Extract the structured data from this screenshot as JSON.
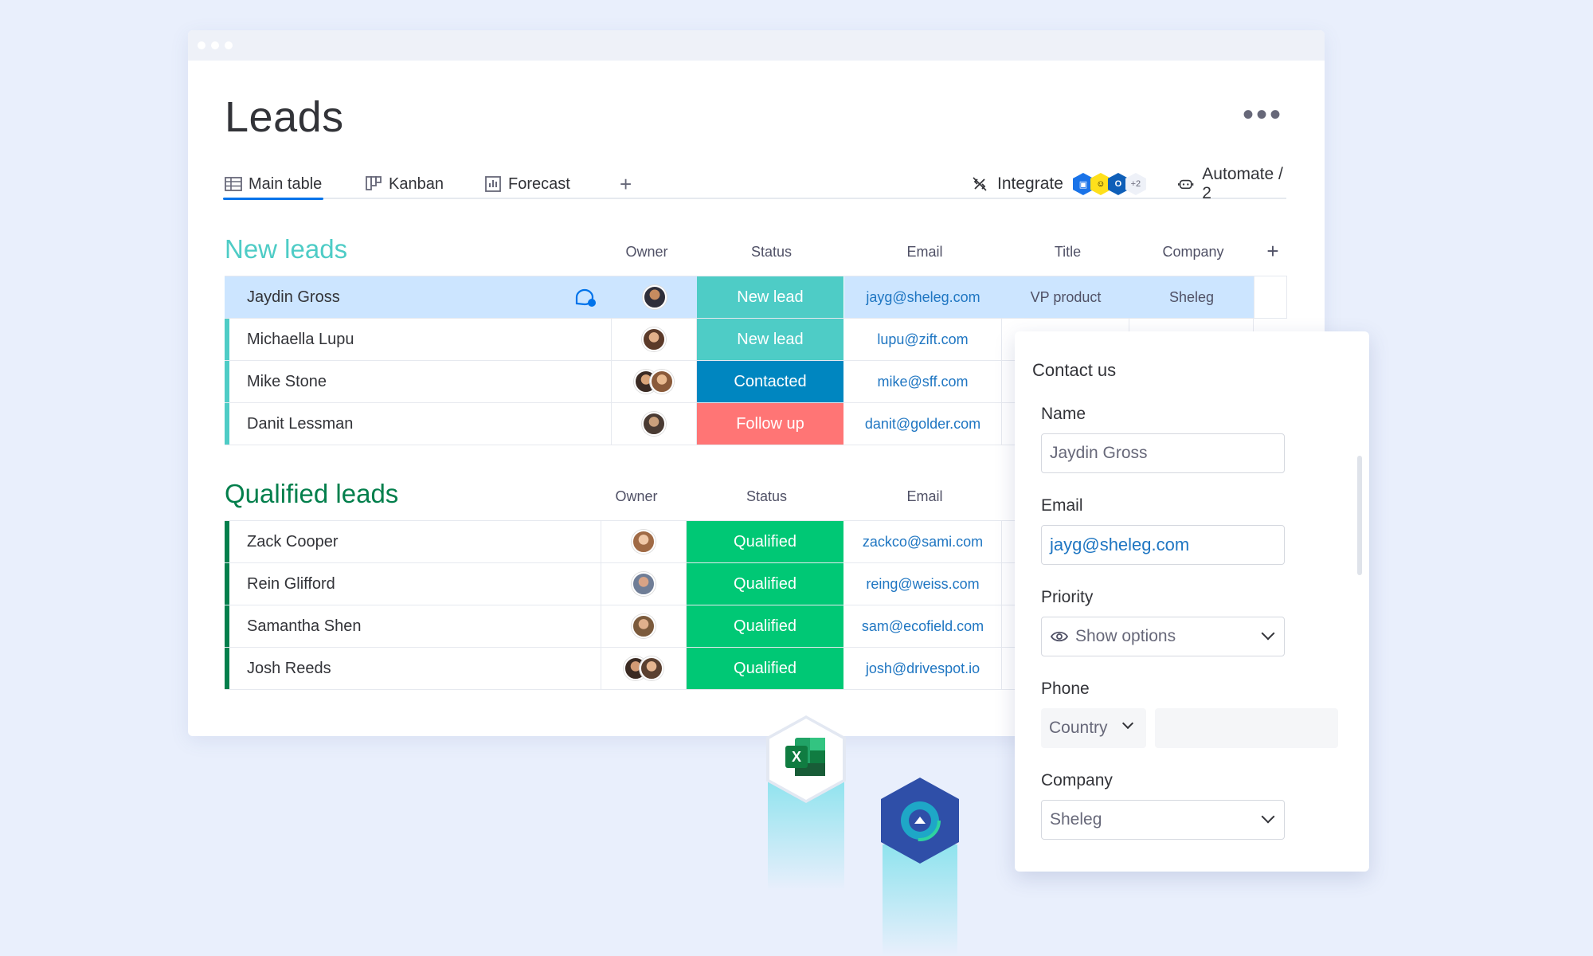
{
  "page": {
    "title": "Leads"
  },
  "tabs": [
    {
      "label": "Main table",
      "icon": "table-icon",
      "active": true
    },
    {
      "label": "Kanban",
      "icon": "kanban-icon"
    },
    {
      "label": "Forecast",
      "icon": "chart-icon"
    }
  ],
  "toolbar": {
    "add_tab": "+",
    "integrate_label": "Integrate",
    "integrations_more": "+2",
    "automate_label": "Automate / 2",
    "more": "•••"
  },
  "new_leads": {
    "title": "New leads",
    "accent_color": "#4eccc6",
    "columns": [
      "Owner",
      "Status",
      "Email",
      "Title",
      "Company"
    ],
    "add_column": "+",
    "rows": [
      {
        "name": "Jaydin Gross",
        "status": "New lead",
        "status_color": "#4eccc6",
        "email": "jayg@sheleg.com",
        "title": "VP product",
        "company": "Sheleg",
        "selected": true
      },
      {
        "name": "Michaella Lupu",
        "status": "New lead",
        "status_color": "#4eccc6",
        "email": "lupu@zift.com",
        "title": "",
        "company": ""
      },
      {
        "name": "Mike Stone",
        "status": "Contacted",
        "status_color": "#0086c0",
        "email": "mike@sff.com",
        "title": "",
        "company": ""
      },
      {
        "name": "Danit Lessman",
        "status": "Follow up",
        "status_color": "#ff7575",
        "email": "danit@golder.com",
        "title": "",
        "company": ""
      }
    ]
  },
  "qualified_leads": {
    "title": "Qualified leads",
    "accent_color": "#037f4c",
    "columns": [
      "Owner",
      "Status",
      "Email"
    ],
    "rows": [
      {
        "name": "Zack Cooper",
        "status": "Qualified",
        "status_color": "#00c875",
        "email": "zackco@sami.com"
      },
      {
        "name": "Rein Glifford",
        "status": "Qualified",
        "status_color": "#00c875",
        "email": "reing@weiss.com"
      },
      {
        "name": "Samantha Shen",
        "status": "Qualified",
        "status_color": "#00c875",
        "email": "sam@ecofield.com"
      },
      {
        "name": "Josh Reeds",
        "status": "Qualified",
        "status_color": "#00c875",
        "email": "josh@drivespot.io"
      }
    ]
  },
  "form": {
    "title": "Contact us",
    "name_label": "Name",
    "name_value": "Jaydin Gross",
    "email_label": "Email",
    "email_value": "jayg@sheleg.com",
    "priority_label": "Priority",
    "priority_value": "Show options",
    "phone_label": "Phone",
    "country_value": "Country",
    "phone_value": "",
    "company_label": "Company",
    "company_value": "Sheleg"
  },
  "floating_icons": [
    {
      "name": "excel-icon",
      "letter": "X",
      "color": "#1d6f42"
    },
    {
      "name": "app-logo-icon",
      "color": "#2f4fa8"
    }
  ]
}
